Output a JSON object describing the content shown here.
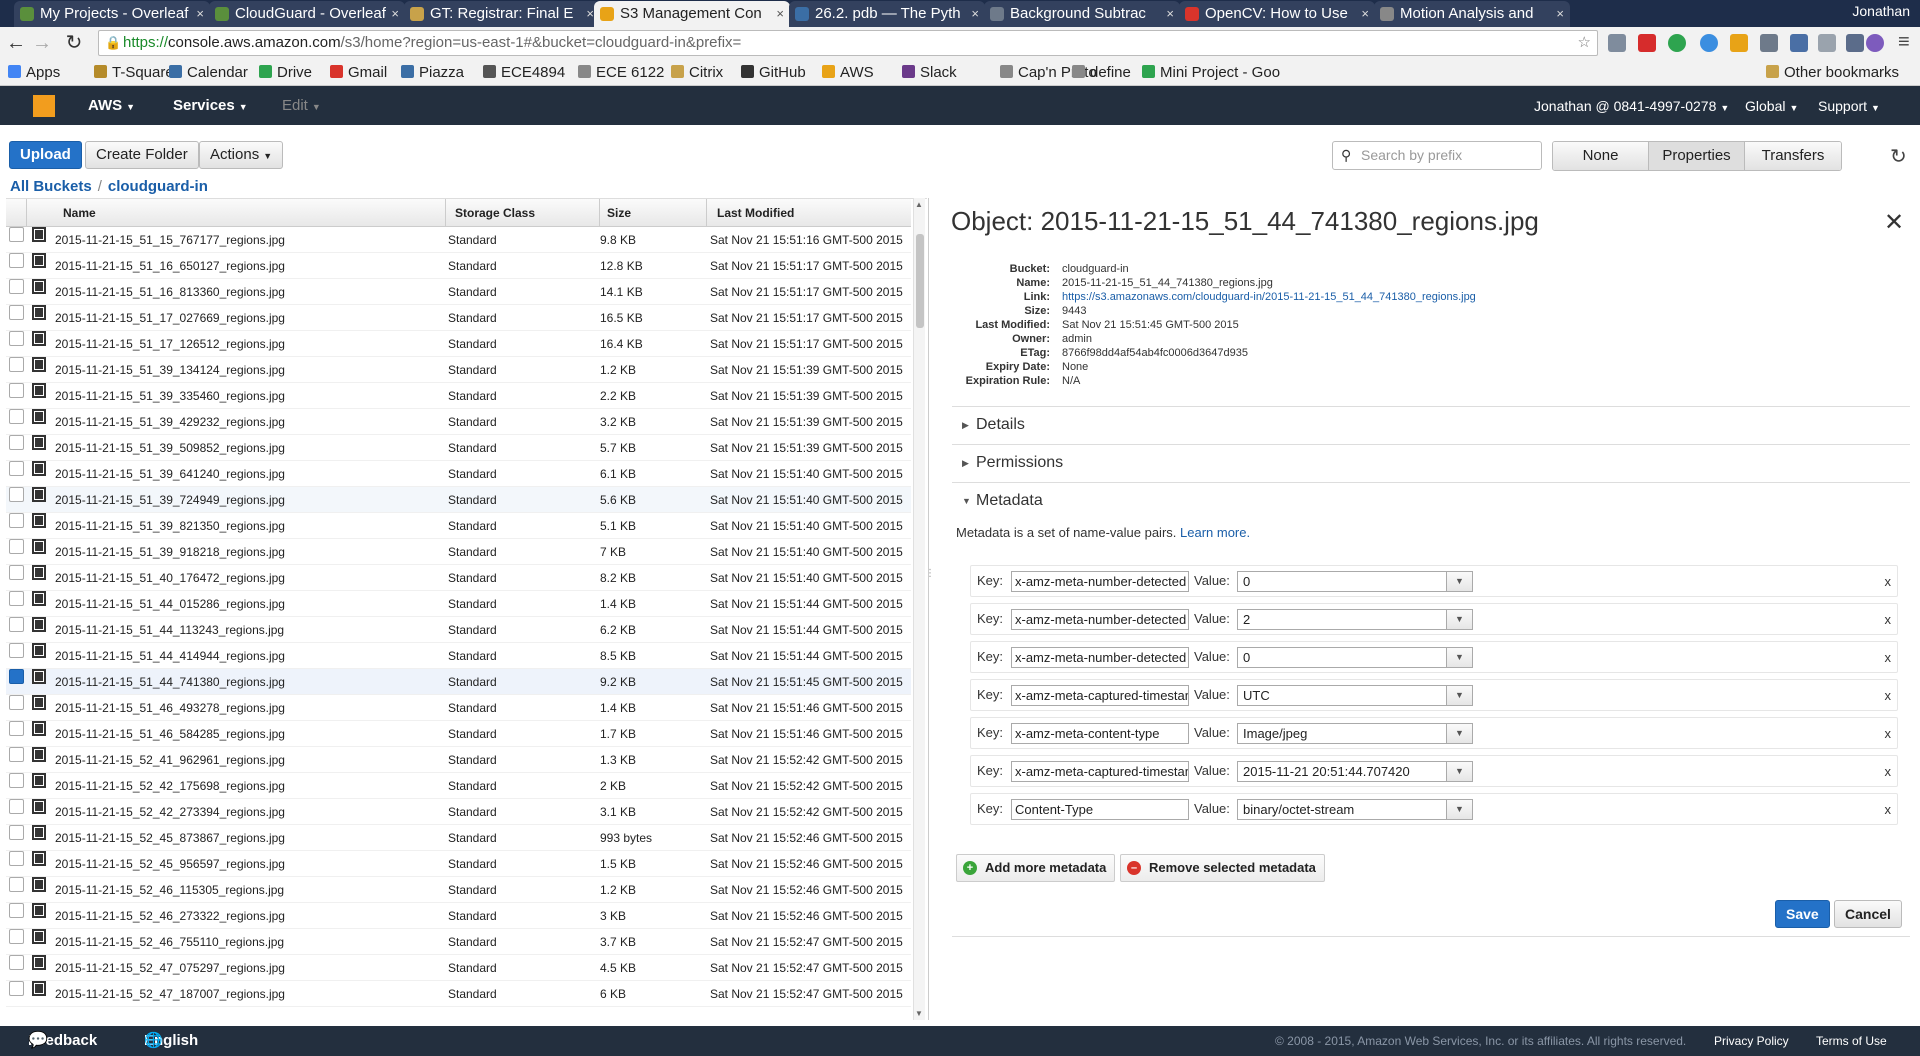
{
  "browser": {
    "tabs": [
      {
        "title": "My Projects - Overleaf"
      },
      {
        "title": "CloudGuard - Overleaf"
      },
      {
        "title": "GT: Registrar: Final E"
      },
      {
        "title": "S3 Management Con"
      },
      {
        "title": "26.2. pdb — The Pyth"
      },
      {
        "title": "Background Subtrac"
      },
      {
        "title": "OpenCV: How to Use"
      },
      {
        "title": "Motion Analysis and"
      }
    ],
    "profile": "Jonathan",
    "url_scheme": "https://",
    "url_host": "console.aws.amazon.com",
    "url_path": "/s3/home?region=us-east-1#&bucket=cloudguard-in&prefix=",
    "bookmarks": [
      "Apps",
      "T-Square",
      "Calendar",
      "Drive",
      "Gmail",
      "Piazza",
      "ECE4894",
      "ECE 6122",
      "Citrix",
      "GitHub",
      "AWS",
      "Slack",
      "Cap'n Proto",
      "define",
      "Mini Project - Goo"
    ],
    "other_bookmarks": "Other bookmarks"
  },
  "aws_header": {
    "brand": "AWS",
    "services": "Services",
    "edit": "Edit",
    "account": "Jonathan @ 0841-4997-0278",
    "region": "Global",
    "support": "Support"
  },
  "toolbar": {
    "upload": "Upload",
    "create_folder": "Create Folder",
    "actions": "Actions",
    "search_placeholder": "Search by prefix",
    "view_none": "None",
    "view_properties": "Properties",
    "view_transfers": "Transfers"
  },
  "breadcrumb": {
    "root": "All Buckets",
    "sep": "/",
    "bucket": "cloudguard-in"
  },
  "columns": {
    "name": "Name",
    "storage_class": "Storage Class",
    "size": "Size",
    "last_modified": "Last Modified"
  },
  "files": [
    {
      "name": "2015-11-21-15_51_15_767177_regions.jpg",
      "storage": "Standard",
      "size": "9.8 KB",
      "modified": "Sat Nov 21 15:51:16 GMT-500 2015"
    },
    {
      "name": "2015-11-21-15_51_16_650127_regions.jpg",
      "storage": "Standard",
      "size": "12.8 KB",
      "modified": "Sat Nov 21 15:51:17 GMT-500 2015"
    },
    {
      "name": "2015-11-21-15_51_16_813360_regions.jpg",
      "storage": "Standard",
      "size": "14.1 KB",
      "modified": "Sat Nov 21 15:51:17 GMT-500 2015"
    },
    {
      "name": "2015-11-21-15_51_17_027669_regions.jpg",
      "storage": "Standard",
      "size": "16.5 KB",
      "modified": "Sat Nov 21 15:51:17 GMT-500 2015"
    },
    {
      "name": "2015-11-21-15_51_17_126512_regions.jpg",
      "storage": "Standard",
      "size": "16.4 KB",
      "modified": "Sat Nov 21 15:51:17 GMT-500 2015"
    },
    {
      "name": "2015-11-21-15_51_39_134124_regions.jpg",
      "storage": "Standard",
      "size": "1.2 KB",
      "modified": "Sat Nov 21 15:51:39 GMT-500 2015"
    },
    {
      "name": "2015-11-21-15_51_39_335460_regions.jpg",
      "storage": "Standard",
      "size": "2.2 KB",
      "modified": "Sat Nov 21 15:51:39 GMT-500 2015"
    },
    {
      "name": "2015-11-21-15_51_39_429232_regions.jpg",
      "storage": "Standard",
      "size": "3.2 KB",
      "modified": "Sat Nov 21 15:51:39 GMT-500 2015"
    },
    {
      "name": "2015-11-21-15_51_39_509852_regions.jpg",
      "storage": "Standard",
      "size": "5.7 KB",
      "modified": "Sat Nov 21 15:51:39 GMT-500 2015"
    },
    {
      "name": "2015-11-21-15_51_39_641240_regions.jpg",
      "storage": "Standard",
      "size": "6.1 KB",
      "modified": "Sat Nov 21 15:51:40 GMT-500 2015"
    },
    {
      "name": "2015-11-21-15_51_39_724949_regions.jpg",
      "storage": "Standard",
      "size": "5.6 KB",
      "modified": "Sat Nov 21 15:51:40 GMT-500 2015"
    },
    {
      "name": "2015-11-21-15_51_39_821350_regions.jpg",
      "storage": "Standard",
      "size": "5.1 KB",
      "modified": "Sat Nov 21 15:51:40 GMT-500 2015"
    },
    {
      "name": "2015-11-21-15_51_39_918218_regions.jpg",
      "storage": "Standard",
      "size": "7 KB",
      "modified": "Sat Nov 21 15:51:40 GMT-500 2015"
    },
    {
      "name": "2015-11-21-15_51_40_176472_regions.jpg",
      "storage": "Standard",
      "size": "8.2 KB",
      "modified": "Sat Nov 21 15:51:40 GMT-500 2015"
    },
    {
      "name": "2015-11-21-15_51_44_015286_regions.jpg",
      "storage": "Standard",
      "size": "1.4 KB",
      "modified": "Sat Nov 21 15:51:44 GMT-500 2015"
    },
    {
      "name": "2015-11-21-15_51_44_113243_regions.jpg",
      "storage": "Standard",
      "size": "6.2 KB",
      "modified": "Sat Nov 21 15:51:44 GMT-500 2015"
    },
    {
      "name": "2015-11-21-15_51_44_414944_regions.jpg",
      "storage": "Standard",
      "size": "8.5 KB",
      "modified": "Sat Nov 21 15:51:44 GMT-500 2015"
    },
    {
      "name": "2015-11-21-15_51_44_741380_regions.jpg",
      "storage": "Standard",
      "size": "9.2 KB",
      "modified": "Sat Nov 21 15:51:45 GMT-500 2015"
    },
    {
      "name": "2015-11-21-15_51_46_493278_regions.jpg",
      "storage": "Standard",
      "size": "1.4 KB",
      "modified": "Sat Nov 21 15:51:46 GMT-500 2015"
    },
    {
      "name": "2015-11-21-15_51_46_584285_regions.jpg",
      "storage": "Standard",
      "size": "1.7 KB",
      "modified": "Sat Nov 21 15:51:46 GMT-500 2015"
    },
    {
      "name": "2015-11-21-15_52_41_962961_regions.jpg",
      "storage": "Standard",
      "size": "1.3 KB",
      "modified": "Sat Nov 21 15:52:42 GMT-500 2015"
    },
    {
      "name": "2015-11-21-15_52_42_175698_regions.jpg",
      "storage": "Standard",
      "size": "2 KB",
      "modified": "Sat Nov 21 15:52:42 GMT-500 2015"
    },
    {
      "name": "2015-11-21-15_52_42_273394_regions.jpg",
      "storage": "Standard",
      "size": "3.1 KB",
      "modified": "Sat Nov 21 15:52:42 GMT-500 2015"
    },
    {
      "name": "2015-11-21-15_52_45_873867_regions.jpg",
      "storage": "Standard",
      "size": "993 bytes",
      "modified": "Sat Nov 21 15:52:46 GMT-500 2015"
    },
    {
      "name": "2015-11-21-15_52_45_956597_regions.jpg",
      "storage": "Standard",
      "size": "1.5 KB",
      "modified": "Sat Nov 21 15:52:46 GMT-500 2015"
    },
    {
      "name": "2015-11-21-15_52_46_115305_regions.jpg",
      "storage": "Standard",
      "size": "1.2 KB",
      "modified": "Sat Nov 21 15:52:46 GMT-500 2015"
    },
    {
      "name": "2015-11-21-15_52_46_273322_regions.jpg",
      "storage": "Standard",
      "size": "3 KB",
      "modified": "Sat Nov 21 15:52:46 GMT-500 2015"
    },
    {
      "name": "2015-11-21-15_52_46_755110_regions.jpg",
      "storage": "Standard",
      "size": "3.7 KB",
      "modified": "Sat Nov 21 15:52:47 GMT-500 2015"
    },
    {
      "name": "2015-11-21-15_52_47_075297_regions.jpg",
      "storage": "Standard",
      "size": "4.5 KB",
      "modified": "Sat Nov 21 15:52:47 GMT-500 2015"
    },
    {
      "name": "2015-11-21-15_52_47_187007_regions.jpg",
      "storage": "Standard",
      "size": "6 KB",
      "modified": "Sat Nov 21 15:52:47 GMT-500 2015"
    }
  ],
  "selected_index": 17,
  "hover_index": 10,
  "object": {
    "title": "Object: 2015-11-21-15_51_44_741380_regions.jpg",
    "props": [
      {
        "k": "Bucket:",
        "v": "cloudguard-in"
      },
      {
        "k": "Name:",
        "v": "2015-11-21-15_51_44_741380_regions.jpg"
      },
      {
        "k": "Link:",
        "v": "https://s3.amazonaws.com/cloudguard-in/2015-11-21-15_51_44_741380_regions.jpg",
        "link": true
      },
      {
        "k": "Size:",
        "v": "9443"
      },
      {
        "k": "Last Modified:",
        "v": "Sat Nov 21 15:51:45 GMT-500 2015"
      },
      {
        "k": "Owner:",
        "v": "admin"
      },
      {
        "k": "ETag:",
        "v": "8766f98dd4af54ab4fc0006d3647d935"
      },
      {
        "k": "Expiry Date:",
        "v": "None"
      },
      {
        "k": "Expiration Rule:",
        "v": "N/A"
      }
    ]
  },
  "sections": {
    "details": "Details",
    "permissions": "Permissions",
    "metadata": "Metadata"
  },
  "metadata": {
    "description": "Metadata is a set of name-value pairs.",
    "learn_more": "Learn more.",
    "key_label": "Key:",
    "value_label": "Value:",
    "remove_glyph": "x",
    "rows": [
      {
        "key": "x-amz-meta-number-detected",
        "value": "0"
      },
      {
        "key": "x-amz-meta-number-detected",
        "value": "2"
      },
      {
        "key": "x-amz-meta-number-detected",
        "value": "0"
      },
      {
        "key": "x-amz-meta-captured-timestamp",
        "value": "UTC"
      },
      {
        "key": "x-amz-meta-content-type",
        "value": "Image/jpeg"
      },
      {
        "key": "x-amz-meta-captured-timestamp",
        "value": "2015-11-21 20:51:44.707420"
      },
      {
        "key": "Content-Type",
        "value": "binary/octet-stream"
      }
    ],
    "add_more": "Add more metadata",
    "remove_selected": "Remove selected metadata",
    "save": "Save",
    "cancel": "Cancel"
  },
  "footer": {
    "feedback": "Feedback",
    "language": "English",
    "copyright": "© 2008 - 2015, Amazon Web Services, Inc. or its affiliates. All rights reserved.",
    "privacy": "Privacy Policy",
    "terms": "Terms of Use"
  },
  "colors": {
    "aws_header": "#232f3e",
    "primary_button": "#2472c8",
    "link": "#1a5ea8",
    "aws_orange": "#f29d1e"
  }
}
